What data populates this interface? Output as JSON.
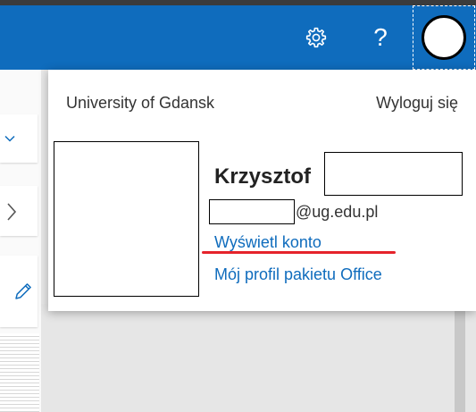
{
  "colors": {
    "brand": "#0f6cbd",
    "link": "#0f6cbd",
    "annotation_underline": "#e5232b"
  },
  "header": {
    "settings_icon": "gear-icon",
    "help_label": "?",
    "avatar_icon": "avatar-circle"
  },
  "sidebar": {
    "icons": [
      "chevron-down-icon",
      "chevron-right-icon",
      "pencil-icon"
    ]
  },
  "account_menu": {
    "organization": "University of Gdansk",
    "sign_out_label": "Wyloguj się",
    "user_first_name": "Krzysztof",
    "email_domain": "@ug.edu.pl",
    "view_account_label": "Wyświetl konto",
    "office_profile_label": "Mój profil pakietu Office"
  }
}
